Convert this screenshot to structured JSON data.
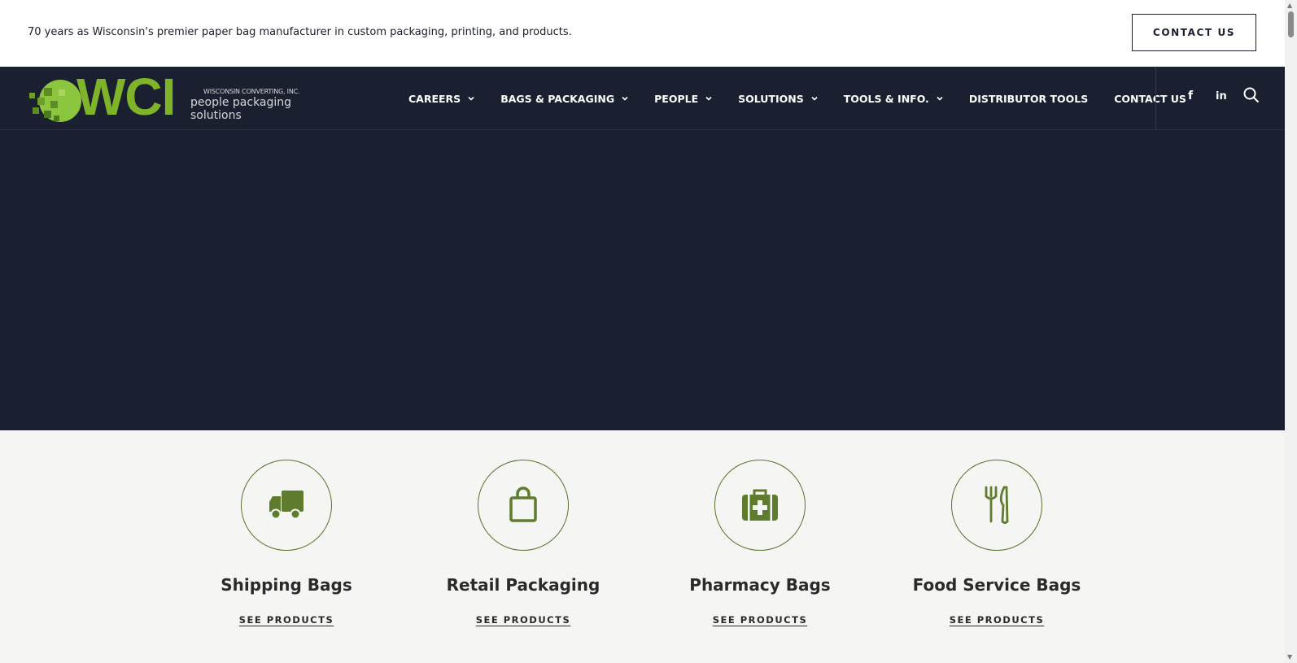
{
  "topbar": {
    "tagline": "70 years as Wisconsin's premier paper bag manufacturer in custom packaging, printing, and products.",
    "contact_label": "CONTACT US"
  },
  "logo": {
    "mark": "WCI",
    "company": "WISCONSIN CONVERTING, INC.",
    "slogan": "people packaging solutions",
    "green": "#7fb32a"
  },
  "nav": {
    "items": [
      {
        "label": "CAREERS",
        "dropdown": true
      },
      {
        "label": "BAGS & PACKAGING",
        "dropdown": true
      },
      {
        "label": "PEOPLE",
        "dropdown": true
      },
      {
        "label": "SOLUTIONS",
        "dropdown": true
      },
      {
        "label": "TOOLS & INFO.",
        "dropdown": true
      },
      {
        "label": "DISTRIBUTOR TOOLS",
        "dropdown": false
      },
      {
        "label": "CONTACT US",
        "dropdown": false
      }
    ],
    "facebook": "f",
    "linkedin": "in",
    "icons": [
      "facebook-icon",
      "linkedin-icon",
      "search-icon"
    ]
  },
  "categories": [
    {
      "title": "Shipping Bags",
      "link": "SEE PRODUCTS",
      "icon": "truck-icon"
    },
    {
      "title": "Retail Packaging",
      "link": "SEE PRODUCTS",
      "icon": "shopping-bag-icon"
    },
    {
      "title": "Pharmacy Bags",
      "link": "SEE PRODUCTS",
      "icon": "medical-kit-icon"
    },
    {
      "title": "Food Service Bags",
      "link": "SEE PRODUCTS",
      "icon": "fork-knife-icon"
    }
  ],
  "colors": {
    "navy": "#1b2030",
    "accent_green": "#56752a",
    "background": "#f5f5f4"
  }
}
